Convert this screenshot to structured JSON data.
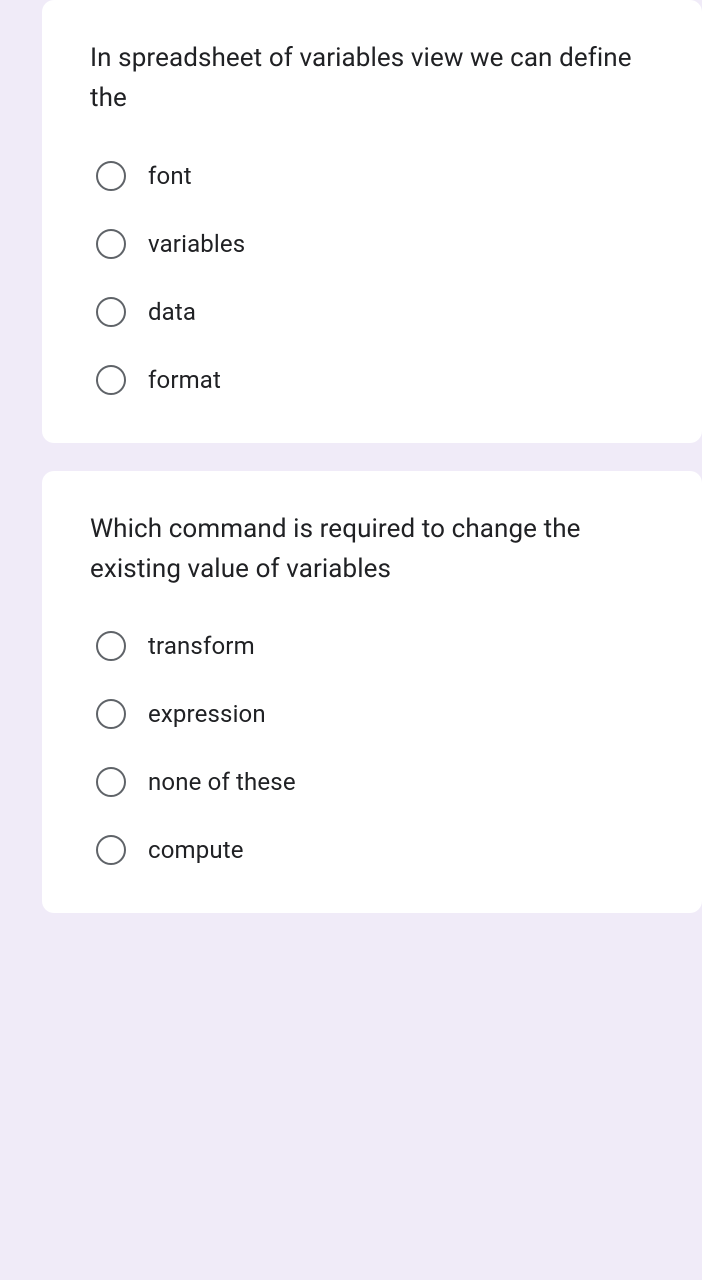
{
  "questions": [
    {
      "text": "In spreadsheet of variables view we can define the",
      "options": [
        "font",
        "variables",
        "data",
        "format"
      ]
    },
    {
      "text": "Which command is required to change the existing value of variables",
      "options": [
        "transform",
        "expression",
        "none of these",
        "compute"
      ]
    }
  ]
}
